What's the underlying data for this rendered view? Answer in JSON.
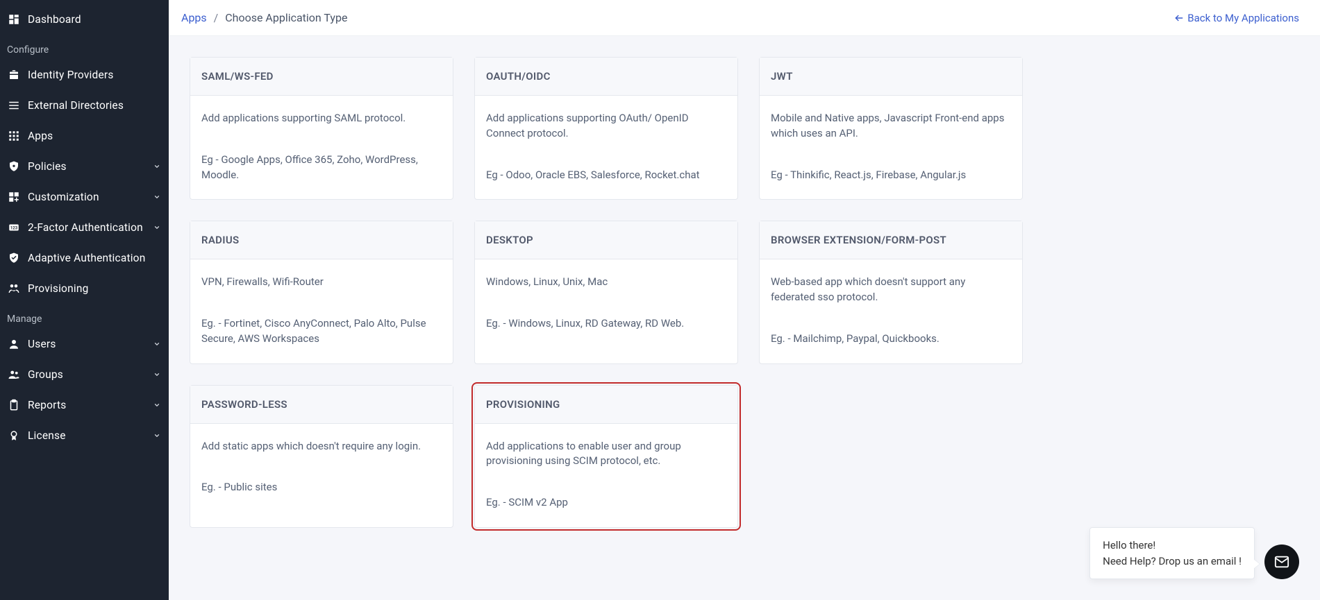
{
  "sidebar": {
    "items": [
      {
        "label": "Dashboard",
        "icon": "dashboard-icon",
        "expandable": false
      },
      {
        "section": "Configure"
      },
      {
        "label": "Identity Providers",
        "icon": "briefcase-icon",
        "expandable": false
      },
      {
        "label": "External Directories",
        "icon": "list-icon",
        "expandable": false
      },
      {
        "label": "Apps",
        "icon": "apps-icon",
        "expandable": false
      },
      {
        "label": "Policies",
        "icon": "shield-settings-icon",
        "expandable": true
      },
      {
        "label": "Customization",
        "icon": "customize-icon",
        "expandable": true
      },
      {
        "label": "2-Factor Authentication",
        "icon": "pin-icon",
        "expandable": true
      },
      {
        "label": "Adaptive Authentication",
        "icon": "shield-check-icon",
        "expandable": false
      },
      {
        "label": "Provisioning",
        "icon": "sync-users-icon",
        "expandable": false
      },
      {
        "section": "Manage"
      },
      {
        "label": "Users",
        "icon": "user-icon",
        "expandable": true
      },
      {
        "label": "Groups",
        "icon": "group-icon",
        "expandable": true
      },
      {
        "label": "Reports",
        "icon": "clipboard-icon",
        "expandable": true
      },
      {
        "label": "License",
        "icon": "license-icon",
        "expandable": true
      }
    ]
  },
  "breadcrumb": {
    "root": "Apps",
    "current": "Choose Application Type"
  },
  "back_link": "Back to My Applications",
  "cards": [
    {
      "title": "SAML/WS-FED",
      "desc": "Add applications supporting SAML protocol.",
      "eg": "Eg - Google Apps, Office 365, Zoho, WordPress, Moodle."
    },
    {
      "title": "OAUTH/OIDC",
      "desc": "Add applications supporting OAuth/ OpenID Connect protocol.",
      "eg": "Eg - Odoo, Oracle EBS, Salesforce, Rocket.chat"
    },
    {
      "title": "JWT",
      "desc": "Mobile and Native apps, Javascript Front-end apps which uses an API.",
      "eg": "Eg - Thinkific, React.js, Firebase, Angular.js"
    },
    {
      "title": "RADIUS",
      "desc": "VPN, Firewalls, Wifi-Router",
      "eg": "Eg. - Fortinet, Cisco AnyConnect, Palo Alto, Pulse Secure, AWS Workspaces"
    },
    {
      "title": "DESKTOP",
      "desc": "Windows, Linux, Unix, Mac",
      "eg": "Eg. - Windows, Linux, RD Gateway, RD Web."
    },
    {
      "title": "BROWSER EXTENSION/FORM-POST",
      "desc": "Web-based app which doesn't support any federated sso protocol.",
      "eg": "Eg. - Mailchimp, Paypal, Quickbooks."
    },
    {
      "title": "PASSWORD-LESS",
      "desc": "Add static apps which doesn't require any login.",
      "eg": "Eg. - Public sites"
    },
    {
      "title": "PROVISIONING",
      "desc": "Add applications to enable user and group provisioning using SCIM protocol, etc.",
      "eg": "Eg. - SCIM v2 App",
      "highlight": true
    }
  ],
  "chat": {
    "line1": "Hello there!",
    "line2": "Need Help? Drop us an email !"
  }
}
